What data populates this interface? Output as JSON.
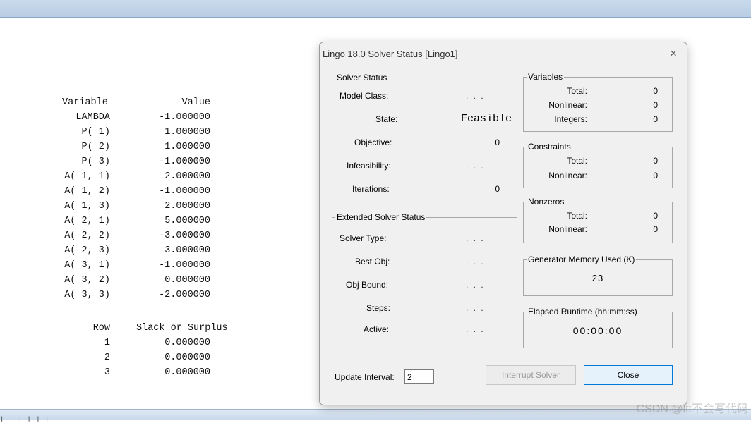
{
  "report": {
    "variable_header": "Variable",
    "value_header": "Value",
    "variables": [
      {
        "name": "LAMBDA",
        "value": "-1.000000"
      },
      {
        "name": "P( 1)",
        "value": "1.000000"
      },
      {
        "name": "P( 2)",
        "value": "1.000000"
      },
      {
        "name": "P( 3)",
        "value": "-1.000000"
      },
      {
        "name": "A( 1, 1)",
        "value": "2.000000"
      },
      {
        "name": "A( 1, 2)",
        "value": "-1.000000"
      },
      {
        "name": "A( 1, 3)",
        "value": "2.000000"
      },
      {
        "name": "A( 2, 1)",
        "value": "5.000000"
      },
      {
        "name": "A( 2, 2)",
        "value": "-3.000000"
      },
      {
        "name": "A( 2, 3)",
        "value": "3.000000"
      },
      {
        "name": "A( 3, 1)",
        "value": "-1.000000"
      },
      {
        "name": "A( 3, 2)",
        "value": "0.000000"
      },
      {
        "name": "A( 3, 3)",
        "value": "-2.000000"
      }
    ],
    "row_header": "Row",
    "slack_header": "Slack or Surplus",
    "rows": [
      {
        "row": "1",
        "slack": "0.000000"
      },
      {
        "row": "2",
        "slack": "0.000000"
      },
      {
        "row": "3",
        "slack": "0.000000"
      }
    ]
  },
  "dialog": {
    "title": "Lingo 18.0 Solver Status [Lingo1]",
    "close_icon": "×",
    "solver_status": {
      "label": "Solver Status",
      "model_class_label": "Model Class:",
      "model_class_value": ". . .",
      "state_label": "State:",
      "state_value": "Feasible",
      "objective_label": "Objective:",
      "objective_value": "0",
      "infeasibility_label": "Infeasibility:",
      "infeasibility_value": ". . .",
      "iterations_label": "Iterations:",
      "iterations_value": "0"
    },
    "extended": {
      "label": "Extended Solver Status",
      "solver_type_label": "Solver Type:",
      "solver_type_value": ". . .",
      "best_obj_label": "Best Obj:",
      "best_obj_value": ". . .",
      "obj_bound_label": "Obj Bound:",
      "obj_bound_value": ". . .",
      "steps_label": "Steps:",
      "steps_value": ". . .",
      "active_label": "Active:",
      "active_value": ". . ."
    },
    "variables": {
      "label": "Variables",
      "total_label": "Total:",
      "total_value": "0",
      "nonlinear_label": "Nonlinear:",
      "nonlinear_value": "0",
      "integers_label": "Integers:",
      "integers_value": "0"
    },
    "constraints": {
      "label": "Constraints",
      "total_label": "Total:",
      "total_value": "0",
      "nonlinear_label": "Nonlinear:",
      "nonlinear_value": "0"
    },
    "nonzeros": {
      "label": "Nonzeros",
      "total_label": "Total:",
      "total_value": "0",
      "nonlinear_label": "Nonlinear:",
      "nonlinear_value": "0"
    },
    "memory": {
      "label": "Generator Memory Used (K)",
      "value": "23"
    },
    "runtime": {
      "label": "Elapsed Runtime (hh:mm:ss)",
      "value": "00:00:00"
    },
    "update_interval_label": "Update Interval:",
    "update_interval_value": "2",
    "interrupt_label": "Interrupt Solver",
    "close_label": "Close"
  },
  "status_ticks": "| | | | | | |",
  "watermark": "CSDN @ltt不会写代码"
}
